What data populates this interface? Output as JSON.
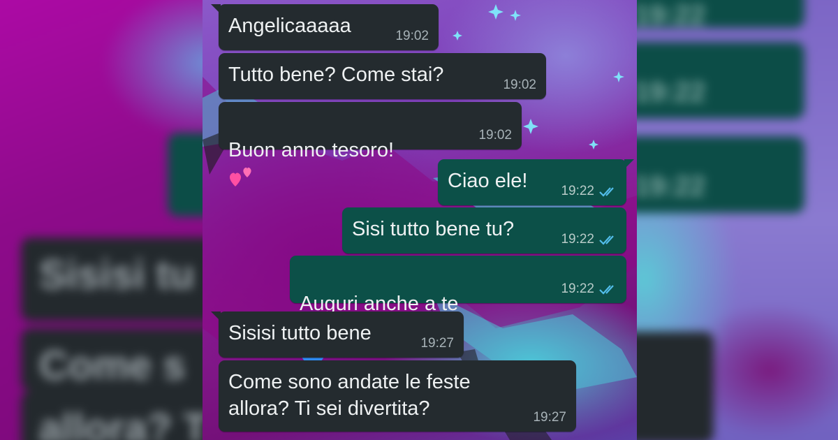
{
  "background_blur": {
    "left_texts": [
      "Sisisi tu",
      "Come s",
      "allora? T"
    ],
    "right_times": [
      "19:22",
      "19:22",
      "19:22"
    ]
  },
  "messages": [
    {
      "direction": "in",
      "text": "Angelicaaaaa",
      "time": "19:02"
    },
    {
      "direction": "in",
      "text": "Tutto bene? Come stai?",
      "time": "19:02"
    },
    {
      "direction": "in",
      "text": "Buon anno tesoro!",
      "emoji": "two-hearts-icon",
      "time": "19:02"
    },
    {
      "direction": "out",
      "text": "Ciao ele!",
      "time": "19:22",
      "status": "read"
    },
    {
      "direction": "out",
      "text": "Sisi tutto bene tu?",
      "time": "19:22",
      "status": "read"
    },
    {
      "direction": "out",
      "text": "Auguri anche a te",
      "emoji": "kiss-face-and-blue-heart-icons",
      "time": "19:22",
      "status": "read"
    },
    {
      "direction": "in",
      "text": "Sisisi tutto bene",
      "time": "19:27"
    },
    {
      "direction": "in",
      "text": "Come sono andate le feste\nallora? Ti sei divertita?",
      "time": "19:27"
    }
  ],
  "colors": {
    "incoming_bubble": "#242b2f",
    "outgoing_bubble": "#0c5048",
    "read_ticks": "#53bdeb"
  }
}
